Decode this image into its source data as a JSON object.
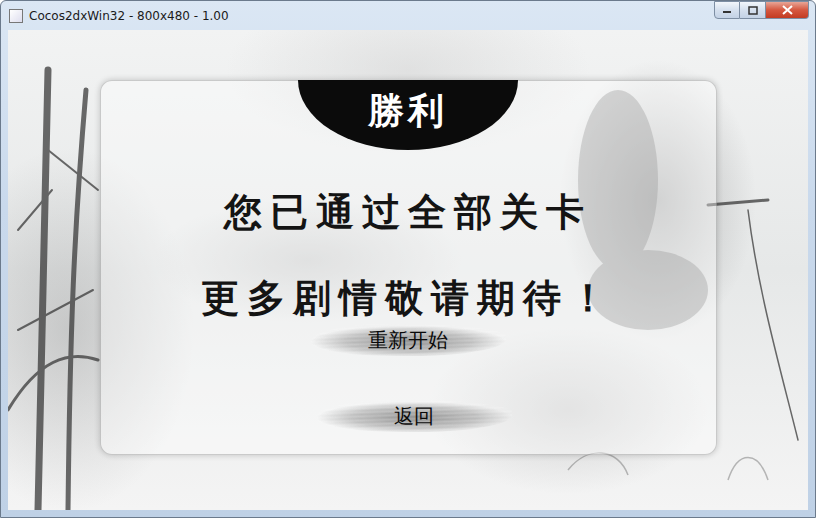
{
  "window": {
    "title": "Cocos2dxWin32 - 800x480 - 1.00"
  },
  "dialog": {
    "badge": "勝利",
    "lines": [
      "您已通过全部关卡",
      "更多剧情敬请期待！"
    ],
    "buttons": [
      {
        "label": "重新开始"
      },
      {
        "label": "返回"
      }
    ]
  }
}
